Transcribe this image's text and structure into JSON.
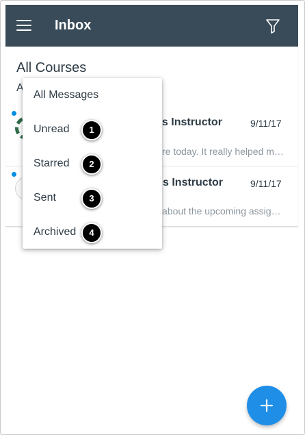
{
  "header": {
    "title": "Inbox",
    "menu_icon": "hamburger-menu-icon",
    "filter_icon": "filter-icon",
    "background_color": "#394b58"
  },
  "inbox": {
    "course_title": "All Courses",
    "filter_label_partial": "A",
    "messages": [
      {
        "name_partial": "as Instructor",
        "date": "9/11/17",
        "preview_partial": "re today. It really helped m…",
        "unread": true
      },
      {
        "name_partial": "s Instructor",
        "date": "9/11/17",
        "preview_partial": "about the upcoming assig…",
        "unread": true
      }
    ]
  },
  "filter_menu": {
    "items": [
      {
        "label": "All Messages"
      },
      {
        "label": "Unread",
        "callout": "1"
      },
      {
        "label": "Starred",
        "callout": "2"
      },
      {
        "label": "Sent",
        "callout": "3"
      },
      {
        "label": "Archived",
        "callout": "4"
      }
    ]
  },
  "fab": {
    "icon": "plus-icon",
    "color": "#1f8ee7"
  },
  "colors": {
    "unread_dot": "#008ee2",
    "text_primary": "#2d3b45",
    "text_secondary": "#8b969e"
  }
}
